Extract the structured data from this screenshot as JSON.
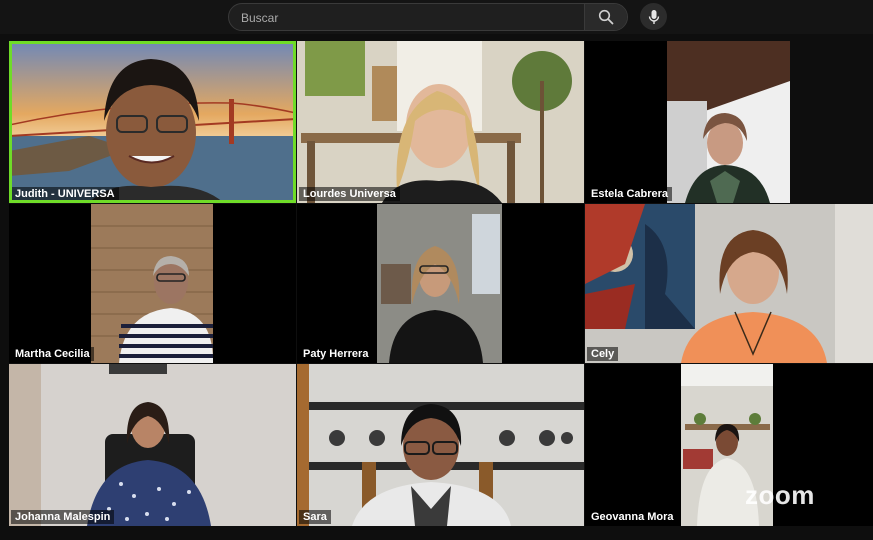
{
  "search": {
    "placeholder": "Buscar"
  },
  "participants": [
    {
      "name": "Judith - UNIVERSA",
      "active_speaker": true
    },
    {
      "name": "Lourdes Universa"
    },
    {
      "name": "Estela Cabrera"
    },
    {
      "name": "Martha Cecilia"
    },
    {
      "name": "Paty Herrera"
    },
    {
      "name": "Cely"
    },
    {
      "name": "Johanna Malespin"
    },
    {
      "name": "Sara"
    },
    {
      "name": "Geovanna Mora"
    }
  ],
  "watermark": "zoom",
  "colors": {
    "active_speaker_border": "#6fdc28",
    "background": "#0e0e0e"
  }
}
